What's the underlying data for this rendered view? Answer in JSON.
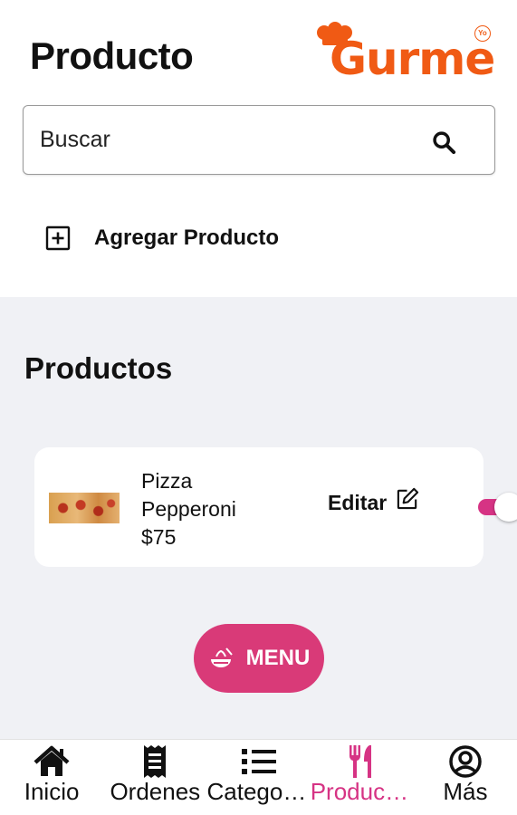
{
  "header": {
    "title": "Producto",
    "logo_text": "Gurme",
    "logo_badge": "Yo"
  },
  "search": {
    "placeholder": "Buscar",
    "value": ""
  },
  "add_product": {
    "label": "Agregar Producto",
    "icon": "plus-square-icon"
  },
  "products_section": {
    "title": "Productos",
    "items": [
      {
        "name": "Pizza Pepperoni",
        "price": "$75",
        "image": "pizza-pepperoni-photo",
        "edit_label": "Editar",
        "enabled": true
      }
    ]
  },
  "menu_button": {
    "label": "MENU",
    "icon": "food-bowl-icon"
  },
  "tabbar": {
    "active": "Productos",
    "tabs": [
      {
        "label": "Inicio",
        "icon": "home-icon"
      },
      {
        "label": "Ordenes",
        "icon": "receipt-icon"
      },
      {
        "label": "Categorias",
        "icon": "list-icon"
      },
      {
        "label": "Productos",
        "icon": "utensils-icon"
      },
      {
        "label": "Más",
        "icon": "user-circle-icon"
      }
    ]
  },
  "colors": {
    "brand_orange": "#f05a14",
    "accent_pink": "#d63384",
    "menu_button_bg": "#d93a78",
    "lower_bg": "#f0f1f5"
  }
}
